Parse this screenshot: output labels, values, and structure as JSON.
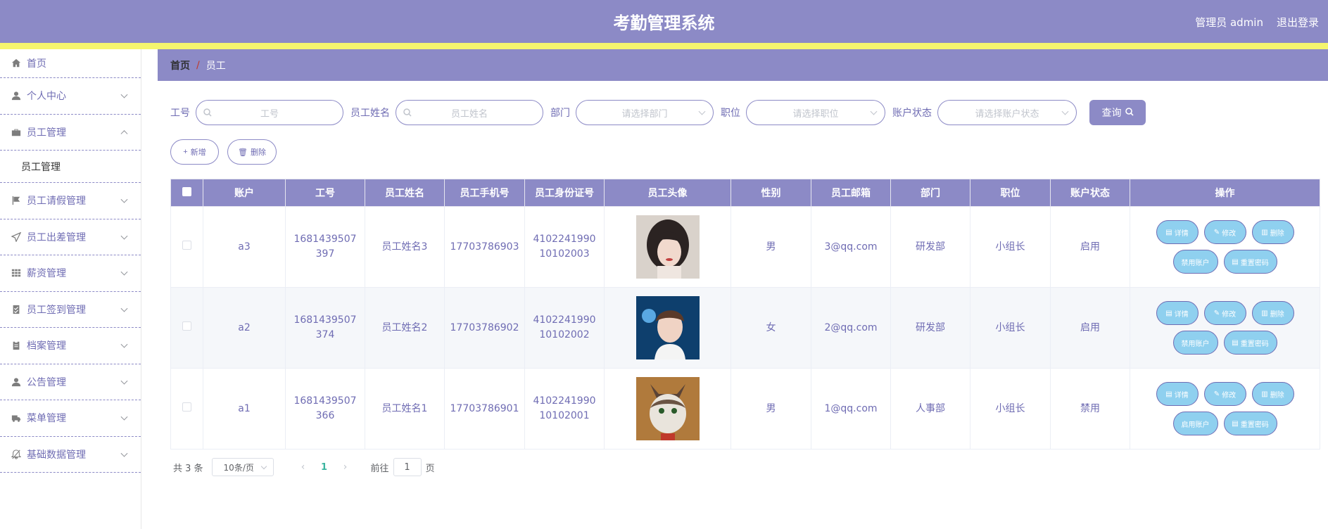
{
  "app": {
    "title": "考勤管理系统",
    "user": "管理员 admin",
    "logout": "退出登录"
  },
  "sidebar": {
    "items": [
      {
        "label": "首页",
        "icon": "home-icon"
      },
      {
        "label": "个人中心",
        "icon": "user-icon"
      },
      {
        "label": "员工管理",
        "icon": "briefcase-icon",
        "sub": "员工管理"
      },
      {
        "label": "员工请假管理",
        "icon": "flag-icon"
      },
      {
        "label": "员工出差管理",
        "icon": "send-icon"
      },
      {
        "label": "薪资管理",
        "icon": "grid-icon"
      },
      {
        "label": "员工签到管理",
        "icon": "checklist-icon"
      },
      {
        "label": "档案管理",
        "icon": "clipboard-icon"
      },
      {
        "label": "公告管理",
        "icon": "user-icon"
      },
      {
        "label": "菜单管理",
        "icon": "truck-icon"
      },
      {
        "label": "基础数据管理",
        "icon": "bell-icon"
      }
    ]
  },
  "breadcrumb": {
    "home": "首页",
    "sep": "/",
    "current": "员工"
  },
  "filters": {
    "gonghao_label": "工号",
    "gonghao_placeholder": "工号",
    "name_label": "员工姓名",
    "name_placeholder": "员工姓名",
    "dept_label": "部门",
    "dept_placeholder": "请选择部门",
    "position_label": "职位",
    "position_placeholder": "请选择职位",
    "status_label": "账户状态",
    "status_placeholder": "请选择账户状态",
    "query": "查询"
  },
  "actions": {
    "add": "新增",
    "delete": "删除"
  },
  "table": {
    "headers": [
      "账户",
      "工号",
      "员工姓名",
      "员工手机号",
      "员工身份证号",
      "员工头像",
      "性别",
      "员工邮箱",
      "部门",
      "职位",
      "账户状态",
      "操作"
    ],
    "rows": [
      {
        "account": "a3",
        "gonghao_1": "1681439507397",
        "name": "员工姓名3",
        "phone": "17703786903",
        "idcard": "410224199010102003",
        "avatar": "avatar-girl",
        "gender": "男",
        "email": "3@qq.com",
        "dept": "研发部",
        "position": "小组长",
        "status": "启用",
        "ops": {
          "detail": "详情",
          "edit": "修改",
          "del": "删除",
          "toggle": "禁用账户",
          "reset": "重置密码"
        }
      },
      {
        "account": "a2",
        "gonghao_1": "1681439507374",
        "name": "员工姓名2",
        "phone": "17703786902",
        "idcard": "410224199010102002",
        "avatar": "avatar-boy",
        "gender": "女",
        "email": "2@qq.com",
        "dept": "研发部",
        "position": "小组长",
        "status": "启用",
        "ops": {
          "detail": "详情",
          "edit": "修改",
          "del": "删除",
          "toggle": "禁用账户",
          "reset": "重置密码"
        }
      },
      {
        "account": "a1",
        "gonghao_1": "1681439507366",
        "name": "员工姓名1",
        "phone": "17703786901",
        "idcard": "410224199010102001",
        "avatar": "avatar-cat",
        "gender": "男",
        "email": "1@qq.com",
        "dept": "人事部",
        "position": "小组长",
        "status": "禁用",
        "ops": {
          "detail": "详情",
          "edit": "修改",
          "del": "删除",
          "toggle": "启用账户",
          "reset": "重置密码"
        }
      }
    ]
  },
  "pager": {
    "total": "共 3 条",
    "size": "10条/页",
    "page": "1",
    "goto": "前往",
    "goto_value": "1",
    "page_unit": "页"
  },
  "colors": {
    "primary": "#8c8ac6",
    "accent_yellow": "#f5f56e",
    "op_button": "#8fd0ef"
  }
}
